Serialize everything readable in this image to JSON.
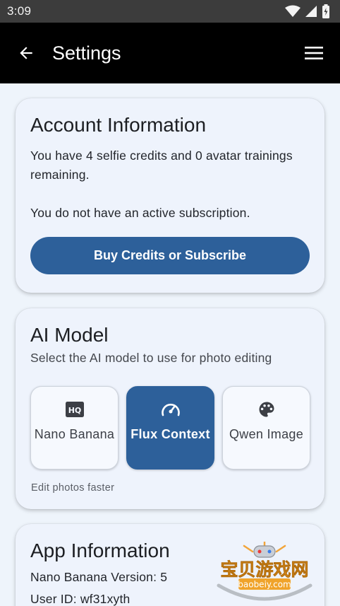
{
  "status_bar": {
    "time": "3:09",
    "icons": [
      "wifi-icon",
      "signal-icon",
      "battery-icon"
    ]
  },
  "app_bar": {
    "title": "Settings",
    "back_icon": "arrow-back-icon",
    "menu_icon": "menu-icon"
  },
  "account": {
    "title": "Account Information",
    "credits_text": "You have 4 selfie credits and 0 avatar trainings remaining.",
    "subscription_text": "You do not have an active subscription.",
    "button_label": "Buy Credits or Subscribe"
  },
  "ai_model": {
    "title": "AI Model",
    "subtitle": "Select the AI model to use for photo editing",
    "options": [
      {
        "label": "Nano Banana",
        "icon": "hq-icon",
        "selected": false
      },
      {
        "label": "Flux Context",
        "icon": "speedometer-icon",
        "selected": true
      },
      {
        "label": "Qwen Image",
        "icon": "palette-icon",
        "selected": false
      }
    ],
    "helper_text": "Edit photos faster"
  },
  "app_info": {
    "title": "App Information",
    "version_text": "Nano Banana Version: 5",
    "user_id_text": "User ID: wf31xyth"
  },
  "watermark": {
    "text_cn": "宝贝游戏网",
    "text_url": "baobeiy.com"
  },
  "colors": {
    "primary": "#2d609a",
    "app_bar": "#000000",
    "background": "#eef4fb",
    "card": "#eef3fc"
  }
}
